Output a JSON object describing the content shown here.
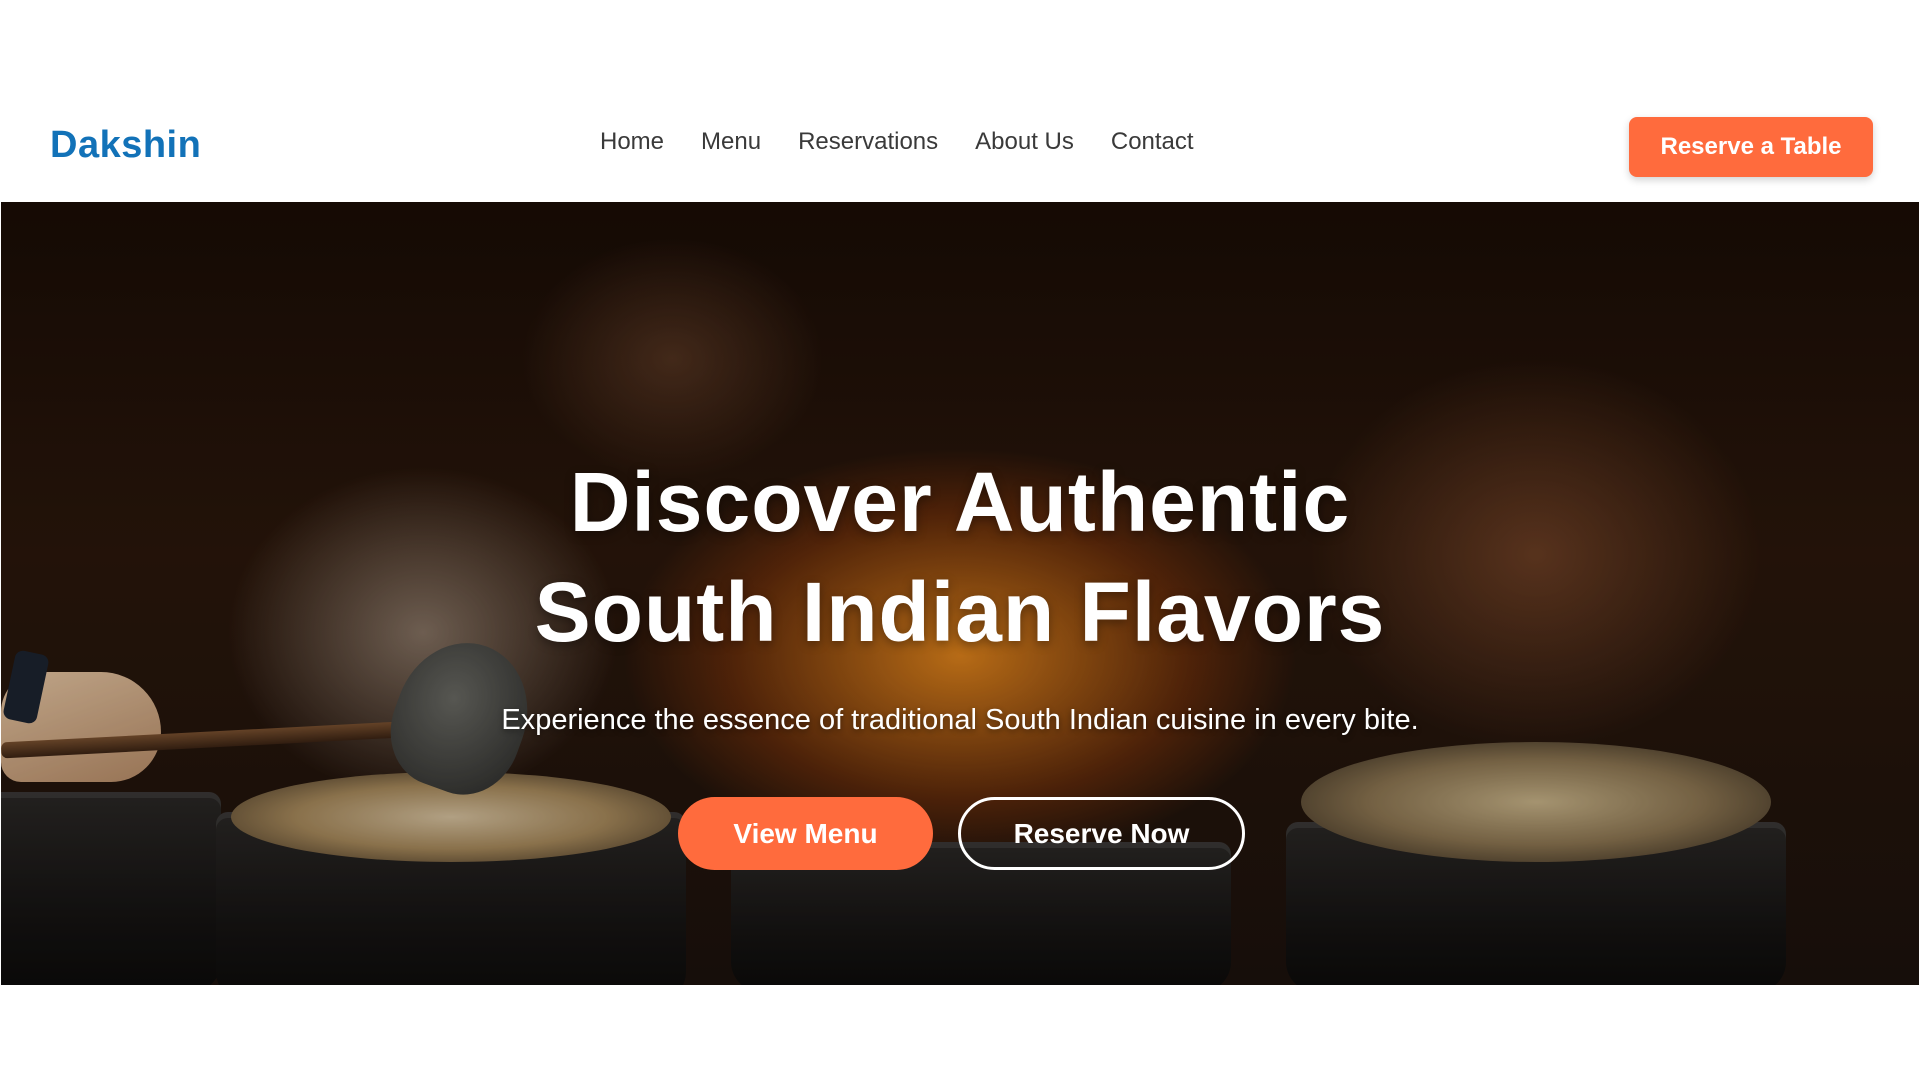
{
  "brand": {
    "name": "Dakshin",
    "color": "#1272b8"
  },
  "nav": {
    "items": [
      {
        "label": "Home"
      },
      {
        "label": "Menu"
      },
      {
        "label": "Reservations"
      },
      {
        "label": "About Us"
      },
      {
        "label": "Contact"
      }
    ]
  },
  "header": {
    "cta_label": "Reserve a Table"
  },
  "hero": {
    "title_line1": "Discover Authentic",
    "title_line2": "South Indian Flavors",
    "subtitle": "Experience the essence of traditional South Indian cuisine in every bite.",
    "primary_button": "View Menu",
    "secondary_button": "Reserve Now"
  },
  "colors": {
    "accent": "#ff6b3d",
    "text_dark": "#3a3a3a",
    "white": "#ffffff"
  }
}
